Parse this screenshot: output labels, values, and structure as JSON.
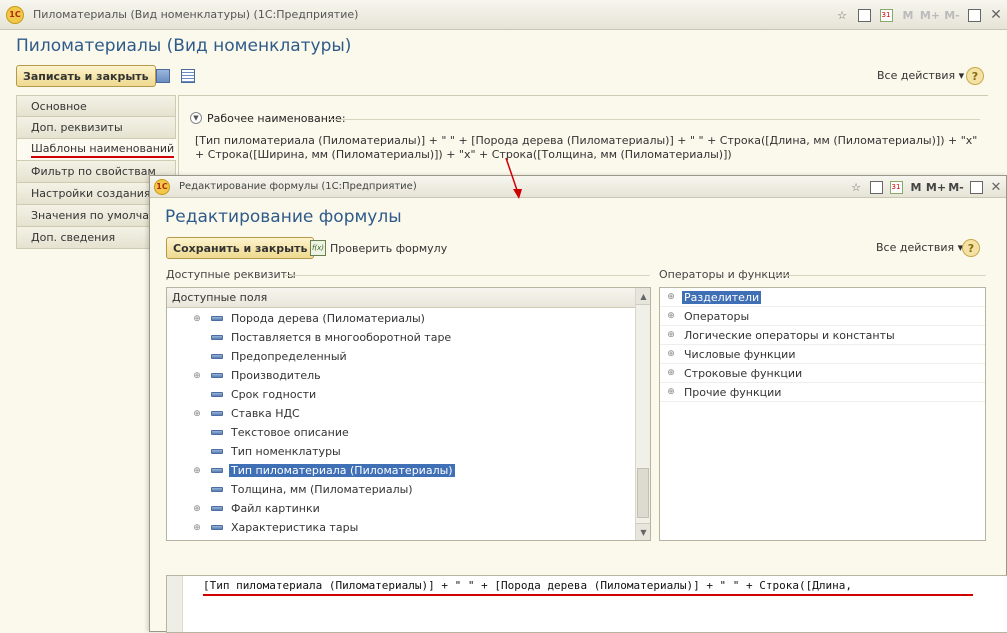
{
  "main_window": {
    "title": "Пиломатериалы (Вид номенклатуры)  (1С:Предприятие)",
    "heading": "Пиломатериалы (Вид номенклатуры)",
    "save_close_label": "Записать и закрыть",
    "all_actions_label": "Все действия ▾",
    "help_label": "?",
    "titlebar_icons": {
      "calendar_label": "31",
      "m_label": "M",
      "mplus_label": "M+",
      "mminus_label": "M-"
    },
    "tabs": [
      {
        "label": "Основное"
      },
      {
        "label": "Доп. реквизиты"
      },
      {
        "label": "Шаблоны наименований"
      },
      {
        "label": "Фильтр по свойствам"
      },
      {
        "label": "Настройки создания"
      },
      {
        "label": "Значения по умолчанию"
      },
      {
        "label": "Доп. сведения"
      }
    ],
    "active_tab": "Шаблоны наименований",
    "section_label": "Рабочее наименование:",
    "formula_text": "[Тип пиломатериала (Пиломатериалы)] + \" \" + [Порода дерева (Пиломатериалы)] + \" \" + Строка([Длина, мм (Пиломатериалы)]) + \"x\" + Строка([Ширина, мм (Пиломатериалы)]) + \"x\" + Строка([Толщина, мм (Пиломатериалы)])"
  },
  "dialog": {
    "title": "Редактирование формулы  (1С:Предприятие)",
    "heading": "Редактирование формулы",
    "save_close_label": "Сохранить и закрыть",
    "check_formula_label": "Проверить формулу",
    "all_actions_label": "Все действия ▾",
    "help_label": "?",
    "titlebar_icons": {
      "calendar_label": "31",
      "m_label": "M",
      "mplus_label": "M+",
      "mminus_label": "M-"
    },
    "attributes_group_label": "Доступные реквизиты",
    "operators_group_label": "Операторы и функции",
    "fields_header": "Доступные поля",
    "fields": [
      {
        "label": "Порода дерева (Пиломатериалы)",
        "expandable": true
      },
      {
        "label": "Поставляется в многооборотной таре",
        "expandable": false
      },
      {
        "label": "Предопределенный",
        "expandable": false
      },
      {
        "label": "Производитель",
        "expandable": true
      },
      {
        "label": "Срок годности",
        "expandable": false
      },
      {
        "label": "Ставка НДС",
        "expandable": true
      },
      {
        "label": "Текстовое описание",
        "expandable": false
      },
      {
        "label": "Тип номенклатуры",
        "expandable": false
      },
      {
        "label": "Тип пиломатериала (Пиломатериалы)",
        "expandable": true,
        "selected": true
      },
      {
        "label": "Толщина, мм (Пиломатериалы)",
        "expandable": false
      },
      {
        "label": "Файл картинки",
        "expandable": true
      },
      {
        "label": "Характеристика тары",
        "expandable": true
      }
    ],
    "operators": [
      {
        "label": "Разделители",
        "selected": true
      },
      {
        "label": "Операторы"
      },
      {
        "label": "Логические операторы и константы"
      },
      {
        "label": "Числовые функции"
      },
      {
        "label": "Строковые функции"
      },
      {
        "label": "Прочие функции"
      }
    ],
    "editor_text": "[Тип пиломатериала (Пиломатериалы)] + \" \" + [Порода дерева (Пиломатериалы)] + \" \" + Строка([Длина,"
  },
  "colors": {
    "heading": "#2f5b8a",
    "selection": "#3f6fb5",
    "annotation_red": "#d10000"
  }
}
